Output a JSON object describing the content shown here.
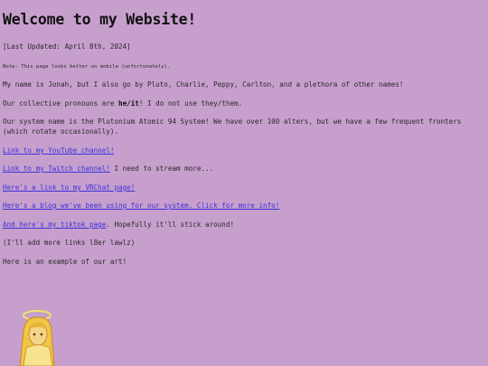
{
  "title": "Welcome to my Website!",
  "last_updated": "[Last Updated: April 8th, 2024]",
  "note": "Note: This page looks better on mobile (unfortunately).",
  "intro": "My name is Jonah, but I also go by Pluto, Charlie, Peppy, Carlton, and a plethora of other names!",
  "pronouns": {
    "before": "Our collective pronouns are ",
    "bold": "he/it",
    "after": "! I do not use they/them."
  },
  "system": "Our system name is the Plutonium Atomic 94 System! We have over 100 alters, but we have a few frequent fronters (which rotate occasionally).",
  "links": {
    "youtube": "Link to my YouTube channel!",
    "twitch": "Link to my Twitch channel!",
    "twitch_after": " I need to stream more...",
    "vrchat": "Here's a link to my VRChat page!",
    "blog": "Here's a blog we've been using for our system. Click for more info!",
    "tiktok": "And here's my tiktok page",
    "tiktok_after": ". Hopefully it'll stick around!"
  },
  "more_links": "(I'll add more links l8er lawlz)",
  "art_intro": "Here is an example of our art!",
  "colors": {
    "background": "#c79fcd",
    "link": "#3a32d8",
    "text": "#2a2a2a"
  }
}
